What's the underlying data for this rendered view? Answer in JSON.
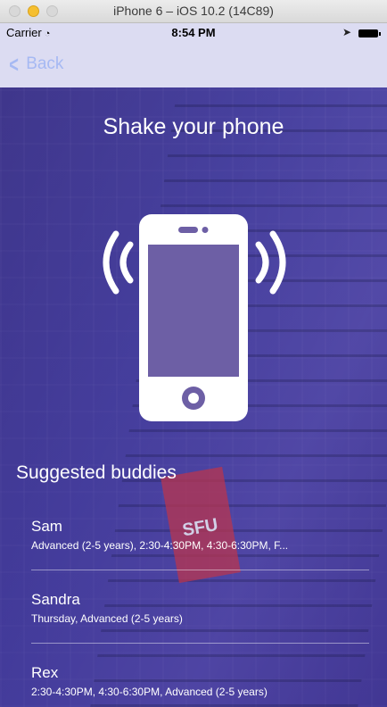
{
  "simulator": {
    "title": "iPhone 6 – iOS 10.2 (14C89)"
  },
  "status_bar": {
    "carrier": "Carrier",
    "time": "8:54 PM"
  },
  "nav": {
    "back_label": "Back"
  },
  "main": {
    "title": "Shake your phone",
    "sign_text": "SFU",
    "suggested_title": "Suggested buddies",
    "buddies": [
      {
        "name": "Sam",
        "detail": "Advanced (2-5 years), 2:30-4:30PM, 4:30-6:30PM, F..."
      },
      {
        "name": "Sandra",
        "detail": "Thursday, Advanced (2-5 years)"
      },
      {
        "name": "Rex",
        "detail": "2:30-4:30PM, 4:30-6:30PM, Advanced (2-5 years)"
      }
    ]
  },
  "colors": {
    "accent": "#a6b9f3",
    "bar_background": "#dcdcf2",
    "overlay": "#5a3fa8"
  }
}
